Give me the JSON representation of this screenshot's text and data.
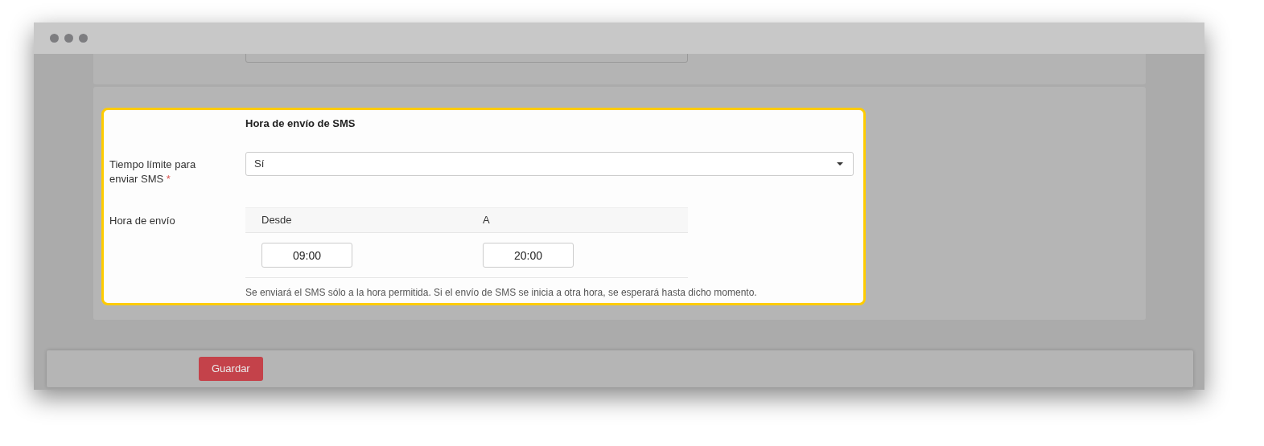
{
  "highlighted_section": {
    "title": "Hora de envío de SMS",
    "fields": [
      {
        "kind": "select",
        "label": "Tiempo límite para enviar SMS",
        "required_mark": "*",
        "value": "Sí"
      },
      {
        "kind": "time_range",
        "label": "Hora de envío",
        "columns": [
          "Desde",
          "A"
        ],
        "values": [
          "09:00",
          "20:00"
        ],
        "help": "Se enviará el SMS sólo a la hora permitida. Si el envío de SMS se inicia a otra hora, se esperará hasta dicho momento."
      }
    ]
  },
  "footer": {
    "buttons": [
      {
        "label": "Guardar"
      }
    ]
  }
}
